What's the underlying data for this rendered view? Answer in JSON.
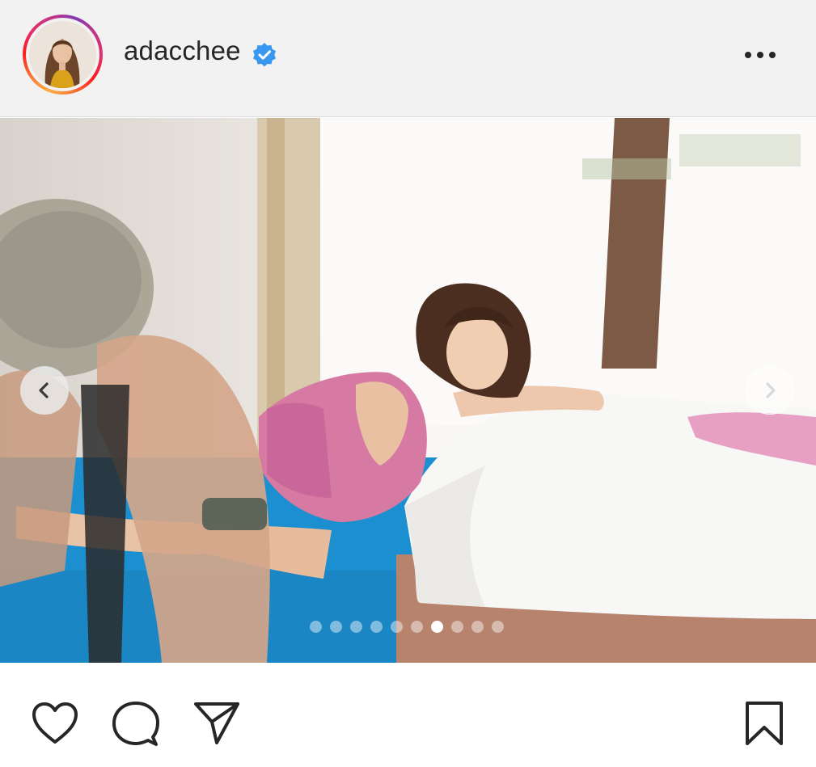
{
  "post": {
    "username": "adacchee",
    "verified": true,
    "more_icon": "more-horizontal-icon",
    "carousel": {
      "total_slides": 10,
      "current_slide": 7,
      "prev_icon": "chevron-left-icon",
      "next_icon": "chevron-right-icon"
    },
    "actions": {
      "like_icon": "heart-icon",
      "comment_icon": "comment-bubble-icon",
      "share_icon": "paper-plane-icon",
      "save_icon": "bookmark-icon"
    }
  },
  "colors": {
    "header_bg": "#f2f2f2",
    "verified_blue": "#3897f0",
    "icon_dark": "#262626",
    "story_ring": [
      "#fcaf45",
      "#fd1d1d",
      "#e1306c",
      "#c13584",
      "#833ab4"
    ]
  }
}
